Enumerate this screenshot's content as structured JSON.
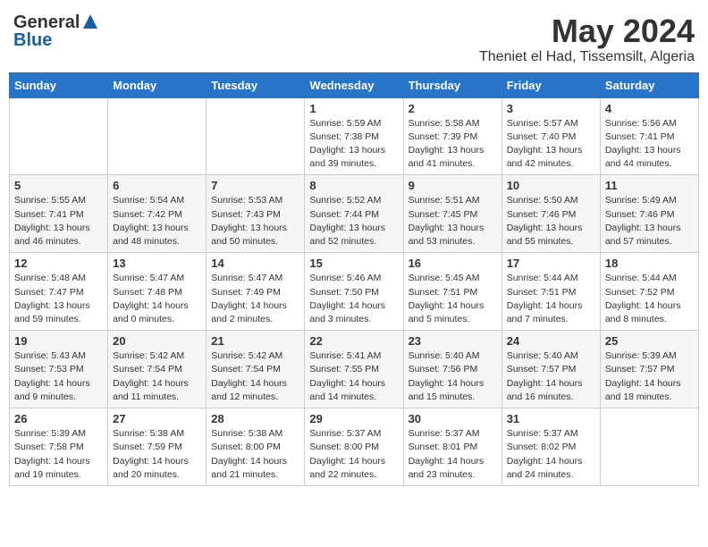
{
  "logo": {
    "general": "General",
    "blue": "Blue"
  },
  "title": {
    "month": "May 2024",
    "location": "Theniet el Had, Tissemsilt, Algeria"
  },
  "weekdays": [
    "Sunday",
    "Monday",
    "Tuesday",
    "Wednesday",
    "Thursday",
    "Friday",
    "Saturday"
  ],
  "weeks": [
    [
      {
        "day": "",
        "sunrise": "",
        "sunset": "",
        "daylight": ""
      },
      {
        "day": "",
        "sunrise": "",
        "sunset": "",
        "daylight": ""
      },
      {
        "day": "",
        "sunrise": "",
        "sunset": "",
        "daylight": ""
      },
      {
        "day": "1",
        "sunrise": "Sunrise: 5:59 AM",
        "sunset": "Sunset: 7:38 PM",
        "daylight": "Daylight: 13 hours and 39 minutes."
      },
      {
        "day": "2",
        "sunrise": "Sunrise: 5:58 AM",
        "sunset": "Sunset: 7:39 PM",
        "daylight": "Daylight: 13 hours and 41 minutes."
      },
      {
        "day": "3",
        "sunrise": "Sunrise: 5:57 AM",
        "sunset": "Sunset: 7:40 PM",
        "daylight": "Daylight: 13 hours and 42 minutes."
      },
      {
        "day": "4",
        "sunrise": "Sunrise: 5:56 AM",
        "sunset": "Sunset: 7:41 PM",
        "daylight": "Daylight: 13 hours and 44 minutes."
      }
    ],
    [
      {
        "day": "5",
        "sunrise": "Sunrise: 5:55 AM",
        "sunset": "Sunset: 7:41 PM",
        "daylight": "Daylight: 13 hours and 46 minutes."
      },
      {
        "day": "6",
        "sunrise": "Sunrise: 5:54 AM",
        "sunset": "Sunset: 7:42 PM",
        "daylight": "Daylight: 13 hours and 48 minutes."
      },
      {
        "day": "7",
        "sunrise": "Sunrise: 5:53 AM",
        "sunset": "Sunset: 7:43 PM",
        "daylight": "Daylight: 13 hours and 50 minutes."
      },
      {
        "day": "8",
        "sunrise": "Sunrise: 5:52 AM",
        "sunset": "Sunset: 7:44 PM",
        "daylight": "Daylight: 13 hours and 52 minutes."
      },
      {
        "day": "9",
        "sunrise": "Sunrise: 5:51 AM",
        "sunset": "Sunset: 7:45 PM",
        "daylight": "Daylight: 13 hours and 53 minutes."
      },
      {
        "day": "10",
        "sunrise": "Sunrise: 5:50 AM",
        "sunset": "Sunset: 7:46 PM",
        "daylight": "Daylight: 13 hours and 55 minutes."
      },
      {
        "day": "11",
        "sunrise": "Sunrise: 5:49 AM",
        "sunset": "Sunset: 7:46 PM",
        "daylight": "Daylight: 13 hours and 57 minutes."
      }
    ],
    [
      {
        "day": "12",
        "sunrise": "Sunrise: 5:48 AM",
        "sunset": "Sunset: 7:47 PM",
        "daylight": "Daylight: 13 hours and 59 minutes."
      },
      {
        "day": "13",
        "sunrise": "Sunrise: 5:47 AM",
        "sunset": "Sunset: 7:48 PM",
        "daylight": "Daylight: 14 hours and 0 minutes."
      },
      {
        "day": "14",
        "sunrise": "Sunrise: 5:47 AM",
        "sunset": "Sunset: 7:49 PM",
        "daylight": "Daylight: 14 hours and 2 minutes."
      },
      {
        "day": "15",
        "sunrise": "Sunrise: 5:46 AM",
        "sunset": "Sunset: 7:50 PM",
        "daylight": "Daylight: 14 hours and 3 minutes."
      },
      {
        "day": "16",
        "sunrise": "Sunrise: 5:45 AM",
        "sunset": "Sunset: 7:51 PM",
        "daylight": "Daylight: 14 hours and 5 minutes."
      },
      {
        "day": "17",
        "sunrise": "Sunrise: 5:44 AM",
        "sunset": "Sunset: 7:51 PM",
        "daylight": "Daylight: 14 hours and 7 minutes."
      },
      {
        "day": "18",
        "sunrise": "Sunrise: 5:44 AM",
        "sunset": "Sunset: 7:52 PM",
        "daylight": "Daylight: 14 hours and 8 minutes."
      }
    ],
    [
      {
        "day": "19",
        "sunrise": "Sunrise: 5:43 AM",
        "sunset": "Sunset: 7:53 PM",
        "daylight": "Daylight: 14 hours and 9 minutes."
      },
      {
        "day": "20",
        "sunrise": "Sunrise: 5:42 AM",
        "sunset": "Sunset: 7:54 PM",
        "daylight": "Daylight: 14 hours and 11 minutes."
      },
      {
        "day": "21",
        "sunrise": "Sunrise: 5:42 AM",
        "sunset": "Sunset: 7:54 PM",
        "daylight": "Daylight: 14 hours and 12 minutes."
      },
      {
        "day": "22",
        "sunrise": "Sunrise: 5:41 AM",
        "sunset": "Sunset: 7:55 PM",
        "daylight": "Daylight: 14 hours and 14 minutes."
      },
      {
        "day": "23",
        "sunrise": "Sunrise: 5:40 AM",
        "sunset": "Sunset: 7:56 PM",
        "daylight": "Daylight: 14 hours and 15 minutes."
      },
      {
        "day": "24",
        "sunrise": "Sunrise: 5:40 AM",
        "sunset": "Sunset: 7:57 PM",
        "daylight": "Daylight: 14 hours and 16 minutes."
      },
      {
        "day": "25",
        "sunrise": "Sunrise: 5:39 AM",
        "sunset": "Sunset: 7:57 PM",
        "daylight": "Daylight: 14 hours and 18 minutes."
      }
    ],
    [
      {
        "day": "26",
        "sunrise": "Sunrise: 5:39 AM",
        "sunset": "Sunset: 7:58 PM",
        "daylight": "Daylight: 14 hours and 19 minutes."
      },
      {
        "day": "27",
        "sunrise": "Sunrise: 5:38 AM",
        "sunset": "Sunset: 7:59 PM",
        "daylight": "Daylight: 14 hours and 20 minutes."
      },
      {
        "day": "28",
        "sunrise": "Sunrise: 5:38 AM",
        "sunset": "Sunset: 8:00 PM",
        "daylight": "Daylight: 14 hours and 21 minutes."
      },
      {
        "day": "29",
        "sunrise": "Sunrise: 5:37 AM",
        "sunset": "Sunset: 8:00 PM",
        "daylight": "Daylight: 14 hours and 22 minutes."
      },
      {
        "day": "30",
        "sunrise": "Sunrise: 5:37 AM",
        "sunset": "Sunset: 8:01 PM",
        "daylight": "Daylight: 14 hours and 23 minutes."
      },
      {
        "day": "31",
        "sunrise": "Sunrise: 5:37 AM",
        "sunset": "Sunset: 8:02 PM",
        "daylight": "Daylight: 14 hours and 24 minutes."
      },
      {
        "day": "",
        "sunrise": "",
        "sunset": "",
        "daylight": ""
      }
    ]
  ]
}
